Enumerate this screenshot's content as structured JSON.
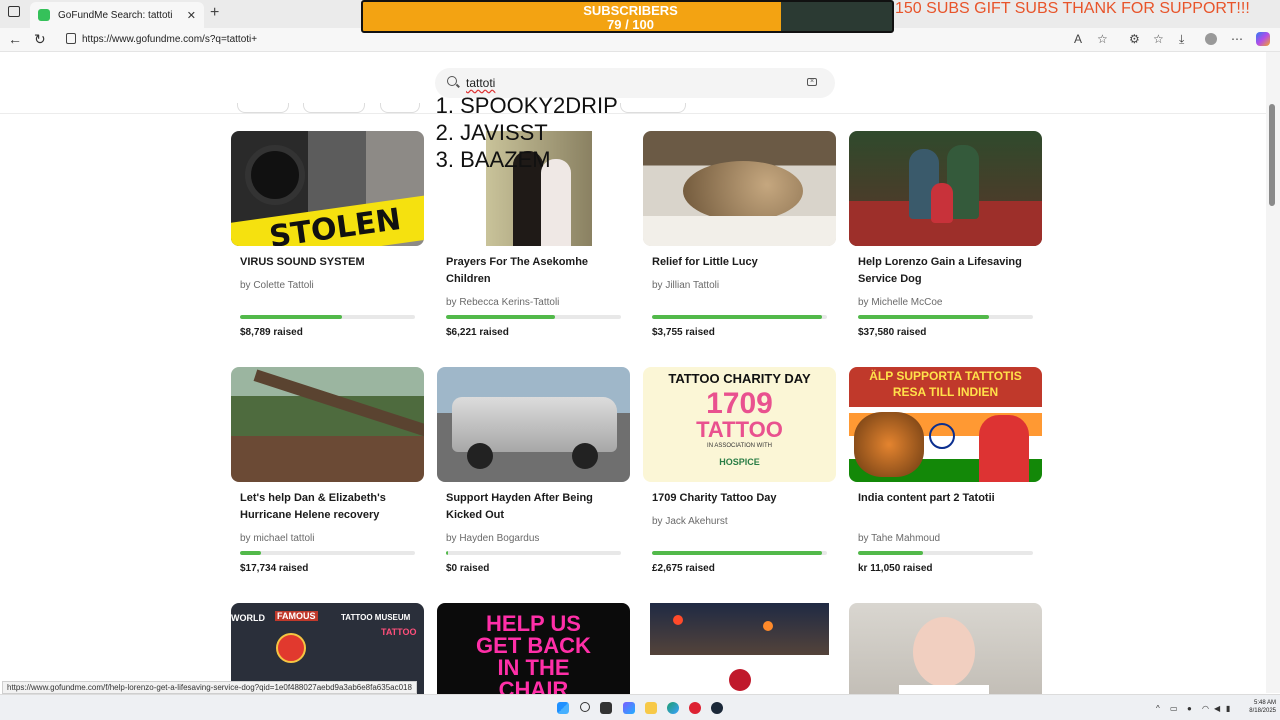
{
  "browser": {
    "tab_title": "GoFundMe Search: tattoti",
    "tab_close": "✕",
    "new_tab": "+",
    "url": "https://www.gofundme.com/s?q=tattoti+",
    "status_url": "https://www.gofundme.com/f/help-lorenzo-get-a-lifesaving-service-dog?qid=1e0f488027aebd9a3ab6e8fa635ac018"
  },
  "overlay": {
    "subscribers_label": "SUBSCRIBERS",
    "subscribers_count": "79 / 100",
    "subscribers_progress": 0.79,
    "gift_message": "150 SUBS GIFT SUBS THANK FOR SUPPORT!!!",
    "leaderboard": [
      {
        "rank": "1.",
        "name": "SPOOKY2DRIP"
      },
      {
        "rank": "2.",
        "name": "JAVISST"
      },
      {
        "rank": "3.",
        "name": "BAAZEM"
      }
    ]
  },
  "search": {
    "query": "tattoti"
  },
  "cards": [
    {
      "title": "VIRUS SOUND SYSTEM",
      "by": "by Colette Tattoli",
      "raised": "$8,789 raised",
      "progress": 0.58,
      "image_label": "STOLEN",
      "image_theme": "stolen-speakers"
    },
    {
      "title": "Prayers For The Asekomhe Children",
      "by": "by Rebecca Kerins-Tattoli",
      "raised": "$6,221 raised",
      "progress": 0.62,
      "image_theme": "portrait-couple"
    },
    {
      "title": "Relief for Little Lucy",
      "by": "by Jillian Tattoli",
      "raised": "$3,755 raised",
      "progress": 0.97,
      "image_theme": "cat"
    },
    {
      "title": "Help Lorenzo Gain a Lifesaving Service Dog",
      "by": "by Michelle McCoe",
      "raised": "$37,580 raised",
      "progress": 0.75,
      "image_theme": "family"
    },
    {
      "title": "Let's help Dan & Elizabeth's Hurricane Helene recovery",
      "by": "by michael tattoli",
      "raised": "$17,734 raised",
      "progress": 0.12,
      "image_theme": "fallen-tree"
    },
    {
      "title": "Support Hayden After Being Kicked Out",
      "by": "by Hayden Bogardus",
      "raised": "$0 raised",
      "progress": 0.01,
      "image_theme": "pickup-truck"
    },
    {
      "title": "1709 Charity Tattoo Day",
      "by": "by Jack Akehurst",
      "raised": "£2,675 raised",
      "progress": 0.97,
      "image_theme": "poster",
      "poster_top": "TATTOO CHARITY DAY",
      "poster_num": "1709",
      "poster_mid": "TATTOO",
      "poster_sub": "IN ASSOCIATION WITH",
      "poster_logo": "HOSPICE"
    },
    {
      "title": "India content part 2 Tatotii",
      "by": "by Tahe Mahmoud",
      "raised": "kr 11,050 raised",
      "progress": 0.37,
      "image_theme": "tiger-india",
      "poster_top": "ÄLP SUPPORTA TATTOTIS",
      "poster_sub": "RESA TILL INDIEN"
    },
    {
      "image_theme": "tattoo-museum",
      "sign_left": "WORLD",
      "sign_mid": "FAMOUS",
      "sign_right": "TATTOO MUSEUM",
      "sign_door": "TATTOO"
    },
    {
      "image_theme": "help-sign",
      "poster_lines": [
        "HELP US",
        "GET BACK",
        "IN THE",
        "CHAIR"
      ]
    },
    {
      "image_theme": "night-street"
    },
    {
      "image_theme": "child-portrait"
    }
  ],
  "taskbar": {
    "time": "5:48 AM",
    "date": "8/18/2025"
  },
  "colors": {
    "progress": "#52b94a",
    "accent_orange": "#f3a312",
    "gift_text": "#e8542a"
  }
}
